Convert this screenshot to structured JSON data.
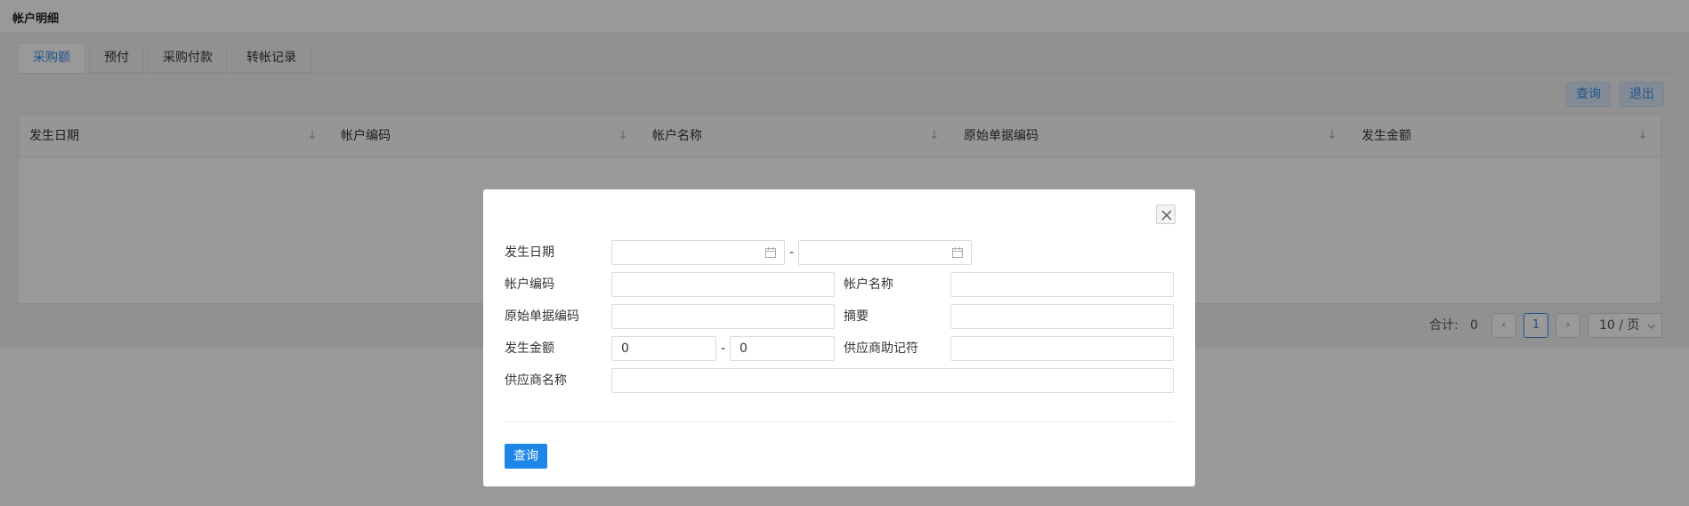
{
  "page": {
    "title": "帐户明细"
  },
  "tabs": [
    {
      "label": "采购额"
    },
    {
      "label": "预付"
    },
    {
      "label": "采购付款"
    },
    {
      "label": "转帐记录"
    }
  ],
  "toolbar": {
    "query_label": "查询",
    "exit_label": "退出"
  },
  "table": {
    "columns": [
      {
        "label": "发生日期"
      },
      {
        "label": "帐户编码"
      },
      {
        "label": "帐户名称"
      },
      {
        "label": "原始单据编码"
      },
      {
        "label": "发生金额"
      }
    ]
  },
  "pagination": {
    "total_label": "合计:",
    "total_value": "0",
    "current_page": "1",
    "page_size": "10 / 页"
  },
  "modal": {
    "fields": {
      "date_label": "发生日期",
      "account_code_label": "帐户编码",
      "account_name_label": "帐户名称",
      "original_doc_label": "原始单据编码",
      "summary_label": "摘要",
      "amount_label": "发生金额",
      "amount_from": "0",
      "amount_to": "0",
      "supplier_mnemonic_label": "供应商助记符",
      "supplier_name_label": "供应商名称"
    },
    "range_sep": "-",
    "submit_label": "查询"
  },
  "colors": {
    "primary": "#1d86e8",
    "tab_active": "#3a8ee6"
  }
}
